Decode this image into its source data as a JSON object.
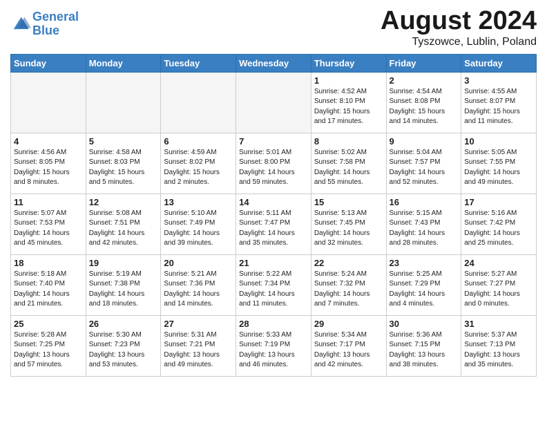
{
  "header": {
    "logo_line1": "General",
    "logo_line2": "Blue",
    "month_title": "August 2024",
    "location": "Tyszowce, Lublin, Poland"
  },
  "weekdays": [
    "Sunday",
    "Monday",
    "Tuesday",
    "Wednesday",
    "Thursday",
    "Friday",
    "Saturday"
  ],
  "weeks": [
    [
      {
        "day": "",
        "info": ""
      },
      {
        "day": "",
        "info": ""
      },
      {
        "day": "",
        "info": ""
      },
      {
        "day": "",
        "info": ""
      },
      {
        "day": "1",
        "info": "Sunrise: 4:52 AM\nSunset: 8:10 PM\nDaylight: 15 hours\nand 17 minutes."
      },
      {
        "day": "2",
        "info": "Sunrise: 4:54 AM\nSunset: 8:08 PM\nDaylight: 15 hours\nand 14 minutes."
      },
      {
        "day": "3",
        "info": "Sunrise: 4:55 AM\nSunset: 8:07 PM\nDaylight: 15 hours\nand 11 minutes."
      }
    ],
    [
      {
        "day": "4",
        "info": "Sunrise: 4:56 AM\nSunset: 8:05 PM\nDaylight: 15 hours\nand 8 minutes."
      },
      {
        "day": "5",
        "info": "Sunrise: 4:58 AM\nSunset: 8:03 PM\nDaylight: 15 hours\nand 5 minutes."
      },
      {
        "day": "6",
        "info": "Sunrise: 4:59 AM\nSunset: 8:02 PM\nDaylight: 15 hours\nand 2 minutes."
      },
      {
        "day": "7",
        "info": "Sunrise: 5:01 AM\nSunset: 8:00 PM\nDaylight: 14 hours\nand 59 minutes."
      },
      {
        "day": "8",
        "info": "Sunrise: 5:02 AM\nSunset: 7:58 PM\nDaylight: 14 hours\nand 55 minutes."
      },
      {
        "day": "9",
        "info": "Sunrise: 5:04 AM\nSunset: 7:57 PM\nDaylight: 14 hours\nand 52 minutes."
      },
      {
        "day": "10",
        "info": "Sunrise: 5:05 AM\nSunset: 7:55 PM\nDaylight: 14 hours\nand 49 minutes."
      }
    ],
    [
      {
        "day": "11",
        "info": "Sunrise: 5:07 AM\nSunset: 7:53 PM\nDaylight: 14 hours\nand 45 minutes."
      },
      {
        "day": "12",
        "info": "Sunrise: 5:08 AM\nSunset: 7:51 PM\nDaylight: 14 hours\nand 42 minutes."
      },
      {
        "day": "13",
        "info": "Sunrise: 5:10 AM\nSunset: 7:49 PM\nDaylight: 14 hours\nand 39 minutes."
      },
      {
        "day": "14",
        "info": "Sunrise: 5:11 AM\nSunset: 7:47 PM\nDaylight: 14 hours\nand 35 minutes."
      },
      {
        "day": "15",
        "info": "Sunrise: 5:13 AM\nSunset: 7:45 PM\nDaylight: 14 hours\nand 32 minutes."
      },
      {
        "day": "16",
        "info": "Sunrise: 5:15 AM\nSunset: 7:43 PM\nDaylight: 14 hours\nand 28 minutes."
      },
      {
        "day": "17",
        "info": "Sunrise: 5:16 AM\nSunset: 7:42 PM\nDaylight: 14 hours\nand 25 minutes."
      }
    ],
    [
      {
        "day": "18",
        "info": "Sunrise: 5:18 AM\nSunset: 7:40 PM\nDaylight: 14 hours\nand 21 minutes."
      },
      {
        "day": "19",
        "info": "Sunrise: 5:19 AM\nSunset: 7:38 PM\nDaylight: 14 hours\nand 18 minutes."
      },
      {
        "day": "20",
        "info": "Sunrise: 5:21 AM\nSunset: 7:36 PM\nDaylight: 14 hours\nand 14 minutes."
      },
      {
        "day": "21",
        "info": "Sunrise: 5:22 AM\nSunset: 7:34 PM\nDaylight: 14 hours\nand 11 minutes."
      },
      {
        "day": "22",
        "info": "Sunrise: 5:24 AM\nSunset: 7:32 PM\nDaylight: 14 hours\nand 7 minutes."
      },
      {
        "day": "23",
        "info": "Sunrise: 5:25 AM\nSunset: 7:29 PM\nDaylight: 14 hours\nand 4 minutes."
      },
      {
        "day": "24",
        "info": "Sunrise: 5:27 AM\nSunset: 7:27 PM\nDaylight: 14 hours\nand 0 minutes."
      }
    ],
    [
      {
        "day": "25",
        "info": "Sunrise: 5:28 AM\nSunset: 7:25 PM\nDaylight: 13 hours\nand 57 minutes."
      },
      {
        "day": "26",
        "info": "Sunrise: 5:30 AM\nSunset: 7:23 PM\nDaylight: 13 hours\nand 53 minutes."
      },
      {
        "day": "27",
        "info": "Sunrise: 5:31 AM\nSunset: 7:21 PM\nDaylight: 13 hours\nand 49 minutes."
      },
      {
        "day": "28",
        "info": "Sunrise: 5:33 AM\nSunset: 7:19 PM\nDaylight: 13 hours\nand 46 minutes."
      },
      {
        "day": "29",
        "info": "Sunrise: 5:34 AM\nSunset: 7:17 PM\nDaylight: 13 hours\nand 42 minutes."
      },
      {
        "day": "30",
        "info": "Sunrise: 5:36 AM\nSunset: 7:15 PM\nDaylight: 13 hours\nand 38 minutes."
      },
      {
        "day": "31",
        "info": "Sunrise: 5:37 AM\nSunset: 7:13 PM\nDaylight: 13 hours\nand 35 minutes."
      }
    ]
  ]
}
